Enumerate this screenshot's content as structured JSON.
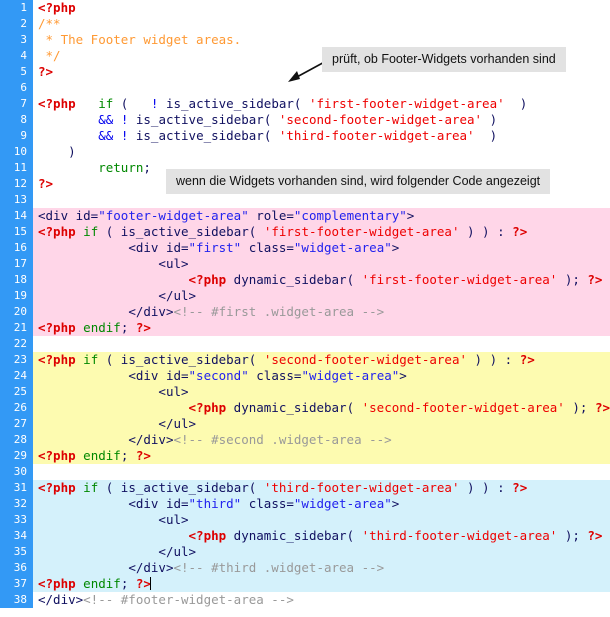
{
  "editor": {
    "filetype": "php",
    "caret_line": 37,
    "gutter_color": "#3399f5",
    "gutter_text_color": "#ffffff",
    "background": "#ffffff",
    "highlight_colors": {
      "none": "#ffffff",
      "pink": "#ffd6e8",
      "yellow": "#fdfbb0",
      "blue": "#d4f1fb"
    },
    "syntax_colors": {
      "php_tag": "#dd0000",
      "string": "#ee0000",
      "keyword": "#008800",
      "operator": "#0000ee",
      "function": "#101060",
      "php_comment": "#ff9933",
      "html_comment": "#999999",
      "html_tag": "#101060",
      "attribute_value": "#2222ee"
    }
  },
  "annotations": [
    {
      "id": "annotation-check-widgets",
      "text": "prüft, ob Footer-Widgets vorhanden sind",
      "has_arrow": true
    },
    {
      "id": "annotation-widgets-present",
      "text": "wenn die Widgets vorhanden sind, wird folgender Code angezeigt",
      "has_arrow": false
    }
  ],
  "lines": [
    {
      "n": "1",
      "hl": "none",
      "tokens": [
        {
          "c": "t-php",
          "t": "<?php"
        }
      ]
    },
    {
      "n": "2",
      "hl": "none",
      "tokens": [
        {
          "c": "t-cmt",
          "t": "/**"
        }
      ]
    },
    {
      "n": "3",
      "hl": "none",
      "tokens": [
        {
          "c": "t-cmt",
          "t": " * The Footer widget areas."
        }
      ]
    },
    {
      "n": "4",
      "hl": "none",
      "tokens": [
        {
          "c": "t-cmt",
          "t": " */"
        }
      ]
    },
    {
      "n": "5",
      "hl": "none",
      "tokens": [
        {
          "c": "t-php",
          "t": "?>"
        }
      ]
    },
    {
      "n": "6",
      "hl": "none",
      "tokens": [
        {
          "c": "t-plain",
          "t": ""
        }
      ]
    },
    {
      "n": "7",
      "hl": "none",
      "tokens": [
        {
          "c": "t-php",
          "t": "<?php"
        },
        {
          "c": "t-plain",
          "t": "   "
        },
        {
          "c": "t-kw",
          "t": "if"
        },
        {
          "c": "t-plain",
          "t": " ( "
        },
        {
          "c": "t-op",
          "t": "  !"
        },
        {
          "c": "t-plain",
          "t": " is_active_sidebar"
        },
        {
          "c": "t-plain",
          "t": "( "
        },
        {
          "c": "t-str",
          "t": "'first-footer-widget-area'"
        },
        {
          "c": "t-plain",
          "t": "  )"
        }
      ]
    },
    {
      "n": "8",
      "hl": "none",
      "tokens": [
        {
          "c": "t-plain",
          "t": "        "
        },
        {
          "c": "t-op",
          "t": "&&"
        },
        {
          "c": "t-plain",
          "t": " "
        },
        {
          "c": "t-op",
          "t": "!"
        },
        {
          "c": "t-plain",
          "t": " is_active_sidebar"
        },
        {
          "c": "t-plain",
          "t": "( "
        },
        {
          "c": "t-str",
          "t": "'second-footer-widget-area'"
        },
        {
          "c": "t-plain",
          "t": " )"
        }
      ]
    },
    {
      "n": "9",
      "hl": "none",
      "tokens": [
        {
          "c": "t-plain",
          "t": "        "
        },
        {
          "c": "t-op",
          "t": "&&"
        },
        {
          "c": "t-plain",
          "t": " "
        },
        {
          "c": "t-op",
          "t": "!"
        },
        {
          "c": "t-plain",
          "t": " is_active_sidebar"
        },
        {
          "c": "t-plain",
          "t": "( "
        },
        {
          "c": "t-str",
          "t": "'third-footer-widget-area'"
        },
        {
          "c": "t-plain",
          "t": "  )"
        }
      ]
    },
    {
      "n": "10",
      "hl": "none",
      "tokens": [
        {
          "c": "t-plain",
          "t": "    )"
        }
      ]
    },
    {
      "n": "11",
      "hl": "none",
      "tokens": [
        {
          "c": "t-plain",
          "t": "        "
        },
        {
          "c": "t-kw",
          "t": "return"
        },
        {
          "c": "t-plain",
          "t": ";"
        }
      ]
    },
    {
      "n": "12",
      "hl": "none",
      "tokens": [
        {
          "c": "t-php",
          "t": "?>"
        }
      ]
    },
    {
      "n": "13",
      "hl": "none",
      "tokens": [
        {
          "c": "t-plain",
          "t": ""
        }
      ]
    },
    {
      "n": "14",
      "hl": "pink",
      "tokens": [
        {
          "c": "t-html",
          "t": "<div id="
        },
        {
          "c": "t-attr",
          "t": "\"footer-widget-area\""
        },
        {
          "c": "t-html",
          "t": " role="
        },
        {
          "c": "t-attr",
          "t": "\"complementary\""
        },
        {
          "c": "t-html",
          "t": ">"
        }
      ]
    },
    {
      "n": "15",
      "hl": "pink",
      "tokens": [
        {
          "c": "t-php",
          "t": "<?php"
        },
        {
          "c": "t-plain",
          "t": " "
        },
        {
          "c": "t-kw",
          "t": "if"
        },
        {
          "c": "t-plain",
          "t": " ( is_active_sidebar( "
        },
        {
          "c": "t-str",
          "t": "'first-footer-widget-area'"
        },
        {
          "c": "t-plain",
          "t": " ) ) : "
        },
        {
          "c": "t-php",
          "t": "?>"
        }
      ]
    },
    {
      "n": "16",
      "hl": "pink",
      "tokens": [
        {
          "c": "t-plain",
          "t": "            "
        },
        {
          "c": "t-html",
          "t": "<div id="
        },
        {
          "c": "t-attr",
          "t": "\"first\""
        },
        {
          "c": "t-html",
          "t": " class="
        },
        {
          "c": "t-attr",
          "t": "\"widget-area\""
        },
        {
          "c": "t-html",
          "t": ">"
        }
      ]
    },
    {
      "n": "17",
      "hl": "pink",
      "tokens": [
        {
          "c": "t-plain",
          "t": "            "
        },
        {
          "c": "t-html",
          "t": "    <ul>"
        }
      ]
    },
    {
      "n": "18",
      "hl": "pink",
      "tokens": [
        {
          "c": "t-plain",
          "t": "                    "
        },
        {
          "c": "t-php",
          "t": "<?php"
        },
        {
          "c": "t-plain",
          "t": " dynamic_sidebar( "
        },
        {
          "c": "t-str",
          "t": "'first-footer-widget-area'"
        },
        {
          "c": "t-plain",
          "t": " ); "
        },
        {
          "c": "t-php",
          "t": "?>"
        }
      ]
    },
    {
      "n": "19",
      "hl": "pink",
      "tokens": [
        {
          "c": "t-plain",
          "t": "            "
        },
        {
          "c": "t-html",
          "t": "    </ul>"
        }
      ]
    },
    {
      "n": "20",
      "hl": "pink",
      "tokens": [
        {
          "c": "t-plain",
          "t": "            "
        },
        {
          "c": "t-html",
          "t": "</div>"
        },
        {
          "c": "t-hcmt",
          "t": "<!-- #first .widget-area -->"
        }
      ]
    },
    {
      "n": "21",
      "hl": "pink",
      "tokens": [
        {
          "c": "t-php",
          "t": "<?php"
        },
        {
          "c": "t-plain",
          "t": " "
        },
        {
          "c": "t-kw",
          "t": "endif"
        },
        {
          "c": "t-plain",
          "t": "; "
        },
        {
          "c": "t-php",
          "t": "?>"
        }
      ]
    },
    {
      "n": "22",
      "hl": "none",
      "tokens": [
        {
          "c": "t-plain",
          "t": ""
        }
      ]
    },
    {
      "n": "23",
      "hl": "yellow",
      "tokens": [
        {
          "c": "t-php",
          "t": "<?php"
        },
        {
          "c": "t-plain",
          "t": " "
        },
        {
          "c": "t-kw",
          "t": "if"
        },
        {
          "c": "t-plain",
          "t": " ( is_active_sidebar( "
        },
        {
          "c": "t-str",
          "t": "'second-footer-widget-area'"
        },
        {
          "c": "t-plain",
          "t": " ) ) : "
        },
        {
          "c": "t-php",
          "t": "?>"
        }
      ]
    },
    {
      "n": "24",
      "hl": "yellow",
      "tokens": [
        {
          "c": "t-plain",
          "t": "            "
        },
        {
          "c": "t-html",
          "t": "<div id="
        },
        {
          "c": "t-attr",
          "t": "\"second\""
        },
        {
          "c": "t-html",
          "t": " class="
        },
        {
          "c": "t-attr",
          "t": "\"widget-area\""
        },
        {
          "c": "t-html",
          "t": ">"
        }
      ]
    },
    {
      "n": "25",
      "hl": "yellow",
      "tokens": [
        {
          "c": "t-plain",
          "t": "            "
        },
        {
          "c": "t-html",
          "t": "    <ul>"
        }
      ]
    },
    {
      "n": "26",
      "hl": "yellow",
      "tokens": [
        {
          "c": "t-plain",
          "t": "                    "
        },
        {
          "c": "t-php",
          "t": "<?php"
        },
        {
          "c": "t-plain",
          "t": " dynamic_sidebar( "
        },
        {
          "c": "t-str",
          "t": "'second-footer-widget-area'"
        },
        {
          "c": "t-plain",
          "t": " ); "
        },
        {
          "c": "t-php",
          "t": "?>"
        }
      ]
    },
    {
      "n": "27",
      "hl": "yellow",
      "tokens": [
        {
          "c": "t-plain",
          "t": "            "
        },
        {
          "c": "t-html",
          "t": "    </ul>"
        }
      ]
    },
    {
      "n": "28",
      "hl": "yellow",
      "tokens": [
        {
          "c": "t-plain",
          "t": "            "
        },
        {
          "c": "t-html",
          "t": "</div>"
        },
        {
          "c": "t-hcmt",
          "t": "<!-- #second .widget-area -->"
        }
      ]
    },
    {
      "n": "29",
      "hl": "yellow",
      "tokens": [
        {
          "c": "t-php",
          "t": "<?php"
        },
        {
          "c": "t-plain",
          "t": " "
        },
        {
          "c": "t-kw",
          "t": "endif"
        },
        {
          "c": "t-plain",
          "t": "; "
        },
        {
          "c": "t-php",
          "t": "?>"
        }
      ]
    },
    {
      "n": "30",
      "hl": "none",
      "tokens": [
        {
          "c": "t-plain",
          "t": ""
        }
      ]
    },
    {
      "n": "31",
      "hl": "blue",
      "tokens": [
        {
          "c": "t-php",
          "t": "<?php"
        },
        {
          "c": "t-plain",
          "t": " "
        },
        {
          "c": "t-kw",
          "t": "if"
        },
        {
          "c": "t-plain",
          "t": " ( is_active_sidebar( "
        },
        {
          "c": "t-str",
          "t": "'third-footer-widget-area'"
        },
        {
          "c": "t-plain",
          "t": " ) ) : "
        },
        {
          "c": "t-php",
          "t": "?>"
        }
      ]
    },
    {
      "n": "32",
      "hl": "blue",
      "tokens": [
        {
          "c": "t-plain",
          "t": "            "
        },
        {
          "c": "t-html",
          "t": "<div id="
        },
        {
          "c": "t-attr",
          "t": "\"third\""
        },
        {
          "c": "t-html",
          "t": " class="
        },
        {
          "c": "t-attr",
          "t": "\"widget-area\""
        },
        {
          "c": "t-html",
          "t": ">"
        }
      ]
    },
    {
      "n": "33",
      "hl": "blue",
      "tokens": [
        {
          "c": "t-plain",
          "t": "            "
        },
        {
          "c": "t-html",
          "t": "    <ul>"
        }
      ]
    },
    {
      "n": "34",
      "hl": "blue",
      "tokens": [
        {
          "c": "t-plain",
          "t": "                    "
        },
        {
          "c": "t-php",
          "t": "<?php"
        },
        {
          "c": "t-plain",
          "t": " dynamic_sidebar( "
        },
        {
          "c": "t-str",
          "t": "'third-footer-widget-area'"
        },
        {
          "c": "t-plain",
          "t": " ); "
        },
        {
          "c": "t-php",
          "t": "?>"
        }
      ]
    },
    {
      "n": "35",
      "hl": "blue",
      "tokens": [
        {
          "c": "t-plain",
          "t": "            "
        },
        {
          "c": "t-html",
          "t": "    </ul>"
        }
      ]
    },
    {
      "n": "36",
      "hl": "blue",
      "tokens": [
        {
          "c": "t-plain",
          "t": "            "
        },
        {
          "c": "t-html",
          "t": "</div>"
        },
        {
          "c": "t-hcmt",
          "t": "<!-- #third .widget-area -->"
        }
      ]
    },
    {
      "n": "37",
      "hl": "blue",
      "caret": true,
      "tokens": [
        {
          "c": "t-php",
          "t": "<?php"
        },
        {
          "c": "t-plain",
          "t": " "
        },
        {
          "c": "t-kw",
          "t": "endif"
        },
        {
          "c": "t-plain",
          "t": "; "
        },
        {
          "c": "t-php",
          "t": "?>"
        }
      ]
    },
    {
      "n": "38",
      "hl": "none",
      "tokens": [
        {
          "c": "t-html",
          "t": "</div>"
        },
        {
          "c": "t-hcmt",
          "t": "<!-- #footer-widget-area -->"
        }
      ]
    }
  ]
}
